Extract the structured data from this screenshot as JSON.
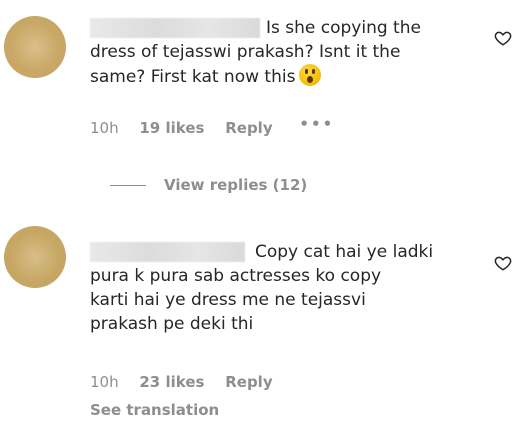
{
  "comments": [
    {
      "lines": [
        "Is she copying the",
        "dress of tejasswi prakash? Isnt it the",
        "same? First kat now this"
      ],
      "emoji": "hushed-face-emoji",
      "time": "10h",
      "likes": "19 likes",
      "reply": "Reply",
      "more": "•••",
      "view_replies": "View replies (12)"
    },
    {
      "lines": [
        "Copy cat hai ye ladki",
        "pura k pura sab actresses ko copy",
        "karti hai ye dress me ne tejassvi",
        "prakash pe deki thi"
      ],
      "time": "10h",
      "likes": "23 likes",
      "reply": "Reply",
      "see_translation": "See translation"
    }
  ],
  "icons": {
    "like": "heart-outline-icon"
  },
  "colors": {
    "text": "#262626",
    "muted": "#8e8e8e",
    "background": "#ffffff"
  }
}
